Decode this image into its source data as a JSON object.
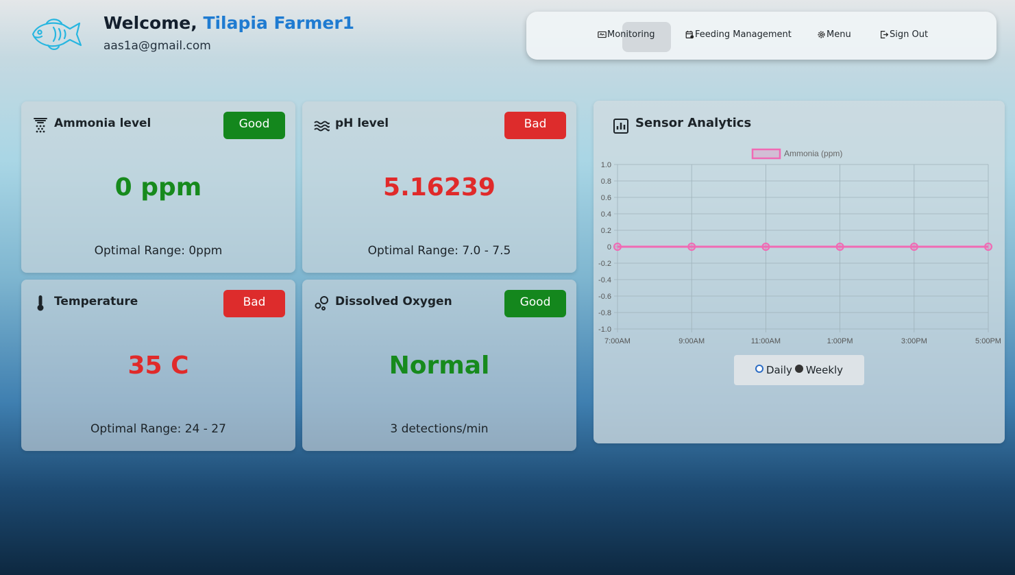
{
  "header": {
    "welcome_prefix": "Welcome,",
    "user_name": "Tilapia Farmer1",
    "email": "aas1a@gmail.com",
    "logo_icon": "fish-icon"
  },
  "nav": {
    "items": [
      {
        "label": "Monitoring",
        "icon": "monitor-icon",
        "active": true
      },
      {
        "label": "Feeding Management",
        "icon": "calendar-gear-icon"
      },
      {
        "label": "Menu",
        "icon": "gear-icon"
      },
      {
        "label": "Sign Out",
        "icon": "sign-out-icon"
      }
    ]
  },
  "cards": [
    {
      "title": "Ammonia level",
      "icon": "ammonia-icon",
      "status": "Good",
      "value": "0 ppm",
      "footer": "Optimal Range: 0ppm"
    },
    {
      "title": "pH level",
      "icon": "water-waves-icon",
      "status": "Bad",
      "value": "5.16239",
      "footer": "Optimal Range: 7.0 - 7.5"
    },
    {
      "title": "Temperature",
      "icon": "thermometer-icon",
      "status": "Bad",
      "value": "35 C",
      "footer": "Optimal Range: 24 - 27"
    },
    {
      "title": "Dissolved Oxygen",
      "icon": "bubbles-icon",
      "status": "Good",
      "value": "Normal",
      "footer": "3 detections/min"
    }
  ],
  "colors": {
    "good": "#14871d",
    "bad": "#dd2c2c",
    "accent": "#1f7bd1",
    "series": "#f06ab4"
  },
  "analytics": {
    "title": "Sensor Analytics",
    "icon": "bar-chart-icon",
    "range_options": [
      "Daily",
      "Weekly"
    ],
    "selected_range": "Daily"
  },
  "chart_data": {
    "type": "line",
    "title": "",
    "x": [
      "7:00AM",
      "9:00AM",
      "11:00AM",
      "1:00PM",
      "3:00PM",
      "5:00PM"
    ],
    "series": [
      {
        "name": "Ammonia (ppm)",
        "values": [
          0,
          0,
          0,
          0,
          0,
          0
        ],
        "color": "#f06ab4"
      }
    ],
    "ylim": [
      -1.0,
      1.0
    ],
    "yticks": [
      "1.0",
      "0.8",
      "0.6",
      "0.4",
      "0.2",
      "0",
      "-0.2",
      "-0.4",
      "-0.6",
      "-0.8",
      "-1.0"
    ],
    "grid": true,
    "legend": "top-center"
  }
}
